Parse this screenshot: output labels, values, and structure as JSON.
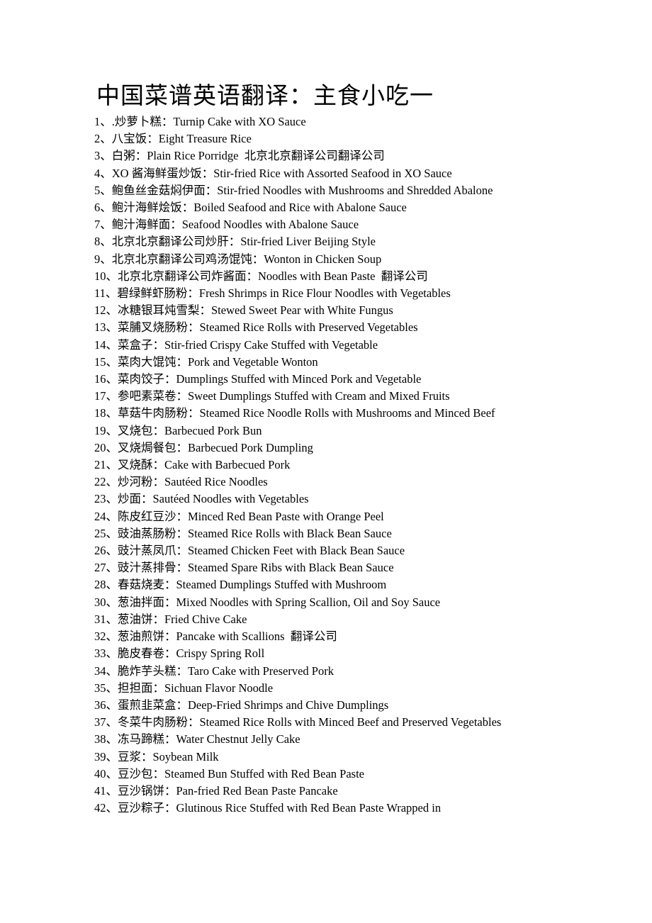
{
  "document": {
    "title": "中国菜谱英语翻译：主食小吃一",
    "separator": "、",
    "colon": "：",
    "space": " "
  },
  "list": {
    "items": [
      {
        "index": "1",
        "cn": ".炒萝卜糕",
        "en": "Turnip Cake with XO Sauce",
        "note": ""
      },
      {
        "index": "2",
        "cn": "八宝饭",
        "en": "Eight Treasure Rice",
        "note": ""
      },
      {
        "index": "3",
        "cn": "白粥",
        "en": "Plain Rice Porridge",
        "note": "北京北京翻译公司翻译公司"
      },
      {
        "index": "4",
        "cn": "XO 酱海鲜蛋炒饭",
        "en": "Stir-fried Rice with Assorted Seafood in XO Sauce",
        "note": ""
      },
      {
        "index": "5",
        "cn": "鲍鱼丝金菇焖伊面",
        "en": "Stir-fried Noodles with Mushrooms and Shredded Abalone",
        "note": ""
      },
      {
        "index": "6",
        "cn": "鲍汁海鲜烩饭",
        "en": "Boiled Seafood and Rice with Abalone Sauce",
        "note": ""
      },
      {
        "index": "7",
        "cn": "鲍汁海鲜面",
        "en": "Seafood Noodles with Abalone Sauce",
        "note": ""
      },
      {
        "index": "8",
        "cn": "北京北京翻译公司炒肝",
        "en": "Stir-fried Liver Beijing Style",
        "note": ""
      },
      {
        "index": "9",
        "cn": "北京北京翻译公司鸡汤馄饨",
        "en": "Wonton in Chicken Soup",
        "note": ""
      },
      {
        "index": "10",
        "cn": "北京北京翻译公司炸酱面",
        "en": "Noodles with Bean Paste",
        "note": "翻译公司"
      },
      {
        "index": "11",
        "cn": "碧绿鲜虾肠粉",
        "en": "Fresh Shrimps in Rice Flour Noodles with Vegetables",
        "note": ""
      },
      {
        "index": "12",
        "cn": "冰糖银耳炖雪梨",
        "en": "Stewed Sweet Pear with White Fungus",
        "note": ""
      },
      {
        "index": "13",
        "cn": "菜脯叉烧肠粉",
        "en": "Steamed Rice Rolls with Preserved Vegetables",
        "note": ""
      },
      {
        "index": "14",
        "cn": "菜盒子",
        "en": "Stir-fried Crispy Cake Stuffed with Vegetable",
        "note": ""
      },
      {
        "index": "15",
        "cn": "菜肉大馄饨",
        "en": "Pork and Vegetable Wonton",
        "note": ""
      },
      {
        "index": "16",
        "cn": "菜肉饺子",
        "en": "Dumplings Stuffed with Minced Pork and Vegetable",
        "note": ""
      },
      {
        "index": "17",
        "cn": "参吧素菜卷",
        "en": "Sweet Dumplings Stuffed with Cream and Mixed Fruits",
        "note": ""
      },
      {
        "index": "18",
        "cn": "草菇牛肉肠粉",
        "en": "Steamed Rice Noodle Rolls with Mushrooms and Minced Beef",
        "note": ""
      },
      {
        "index": "19",
        "cn": "叉烧包",
        "en": "Barbecued Pork Bun",
        "note": ""
      },
      {
        "index": "20",
        "cn": "叉烧焗餐包",
        "en": "Barbecued Pork Dumpling",
        "note": ""
      },
      {
        "index": "21",
        "cn": "叉烧酥",
        "en": "Cake with Barbecued Pork",
        "note": ""
      },
      {
        "index": "22",
        "cn": "炒河粉",
        "en": "Sautéed Rice Noodles",
        "note": ""
      },
      {
        "index": "23",
        "cn": "炒面",
        "en": "Sautéed Noodles with Vegetables",
        "note": ""
      },
      {
        "index": "24",
        "cn": "陈皮红豆沙",
        "en": "Minced Red Bean Paste with Orange Peel",
        "note": ""
      },
      {
        "index": "25",
        "cn": "豉油蒸肠粉",
        "en": "Steamed Rice Rolls with Black Bean Sauce",
        "note": ""
      },
      {
        "index": "26",
        "cn": "豉汁蒸凤爪",
        "en": "Steamed Chicken Feet with Black Bean Sauce",
        "note": ""
      },
      {
        "index": "27",
        "cn": "豉汁蒸排骨",
        "en": "Steamed Spare Ribs with Black Bean Sauce",
        "note": ""
      },
      {
        "index": "28",
        "cn": "春菇烧麦",
        "en": "Steamed Dumplings Stuffed with Mushroom",
        "note": ""
      },
      {
        "index": "30",
        "cn": "葱油拌面",
        "en": "Mixed Noodles with Spring Scallion, Oil and Soy Sauce",
        "note": ""
      },
      {
        "index": "31",
        "cn": "葱油饼",
        "en": "Fried Chive Cake",
        "note": ""
      },
      {
        "index": "32",
        "cn": "葱油煎饼",
        "en": "Pancake with Scallions",
        "note": "翻译公司"
      },
      {
        "index": "33",
        "cn": "脆皮春卷",
        "en": "Crispy Spring Roll",
        "note": ""
      },
      {
        "index": "34",
        "cn": "脆炸芋头糕",
        "en": "Taro Cake with Preserved Pork",
        "note": ""
      },
      {
        "index": "35",
        "cn": "担担面",
        "en": "Sichuan Flavor Noodle",
        "note": ""
      },
      {
        "index": "36",
        "cn": "蛋煎韭菜盒",
        "en": "Deep-Fried Shrimps and Chive Dumplings",
        "note": ""
      },
      {
        "index": "37",
        "cn": "冬菜牛肉肠粉",
        "en": "Steamed Rice Rolls with Minced Beef and Preserved Vegetables",
        "note": ""
      },
      {
        "index": "38",
        "cn": "冻马蹄糕",
        "en": "Water Chestnut Jelly Cake",
        "note": ""
      },
      {
        "index": "39",
        "cn": "豆浆",
        "en": "Soybean Milk",
        "note": ""
      },
      {
        "index": "40",
        "cn": "豆沙包",
        "en": "Steamed Bun Stuffed with Red Bean Paste",
        "note": ""
      },
      {
        "index": "41",
        "cn": "豆沙锅饼",
        "en": "Pan-fried Red Bean Paste Pancake",
        "note": ""
      },
      {
        "index": "42",
        "cn": "豆沙粽子",
        "en": "Glutinous Rice Stuffed with Red Bean Paste Wrapped in",
        "note": ""
      }
    ]
  }
}
